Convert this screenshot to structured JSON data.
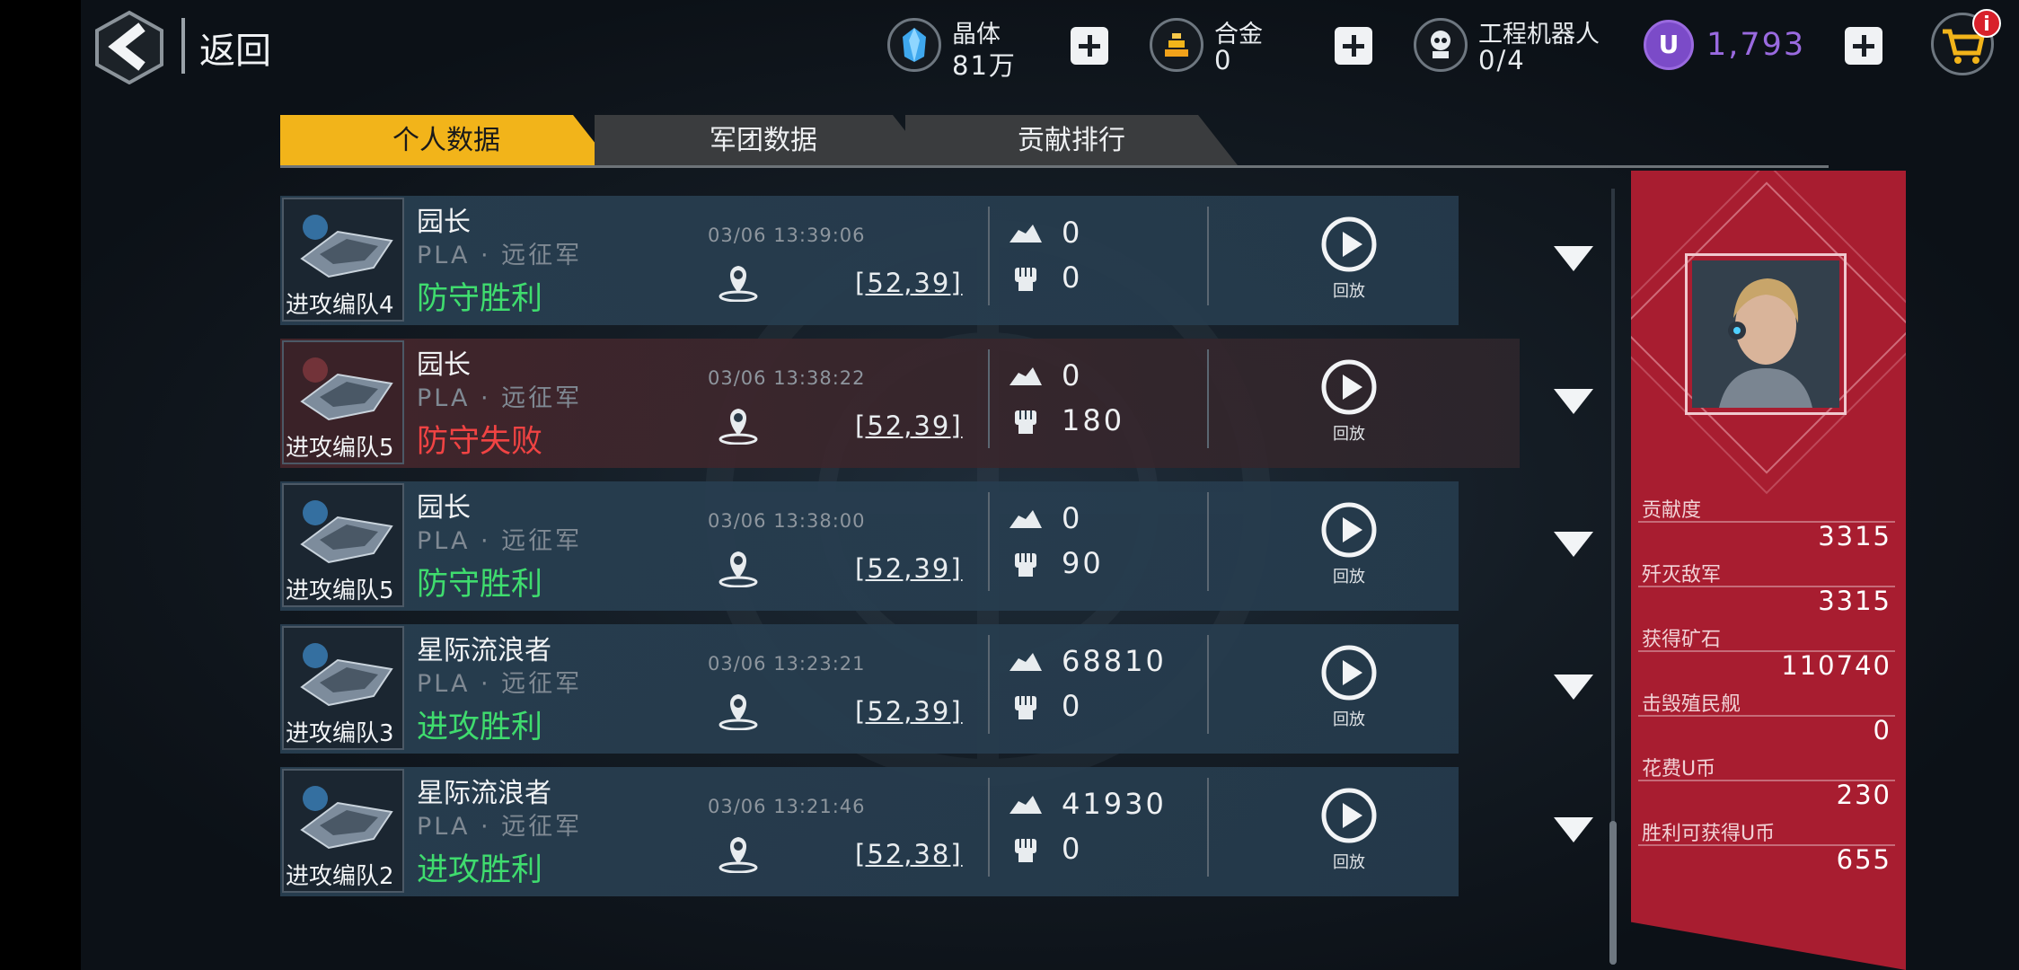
{
  "header": {
    "back_label": "返回",
    "resources": {
      "crystal": {
        "name": "晶体",
        "value": "81万"
      },
      "alloy": {
        "name": "合金",
        "value": "0"
      },
      "robot": {
        "name": "工程机器人",
        "value": "0/4"
      },
      "u_coin": {
        "symbol": "U",
        "value": "1,793"
      }
    },
    "cart_badge": "i"
  },
  "tabs": [
    {
      "label": "个人数据",
      "active": true
    },
    {
      "label": "军团数据",
      "active": false
    },
    {
      "label": "贡献排行",
      "active": false
    }
  ],
  "records": [
    {
      "unit": "进攻编队4",
      "name": "园长",
      "guild": "PLA · 远征军",
      "result": "防守胜利",
      "outcome": "win",
      "time": "03/06 13:39:06",
      "coord": "[52,39]",
      "ore": "0",
      "kills": "0",
      "replay": "回放"
    },
    {
      "unit": "进攻编队5",
      "name": "园长",
      "guild": "PLA · 远征军",
      "result": "防守失败",
      "outcome": "lose",
      "time": "03/06 13:38:22",
      "coord": "[52,39]",
      "ore": "0",
      "kills": "180",
      "replay": "回放"
    },
    {
      "unit": "进攻编队5",
      "name": "园长",
      "guild": "PLA · 远征军",
      "result": "防守胜利",
      "outcome": "win",
      "time": "03/06 13:38:00",
      "coord": "[52,39]",
      "ore": "0",
      "kills": "90",
      "replay": "回放"
    },
    {
      "unit": "进攻编队3",
      "name": "星际流浪者",
      "guild": "PLA · 远征军",
      "result": "进攻胜利",
      "outcome": "win",
      "time": "03/06 13:23:21",
      "coord": "[52,39]",
      "ore": "68810",
      "kills": "0",
      "replay": "回放"
    },
    {
      "unit": "进攻编队2",
      "name": "星际流浪者",
      "guild": "PLA · 远征军",
      "result": "进攻胜利",
      "outcome": "win",
      "time": "03/06 13:21:46",
      "coord": "[52,38]",
      "ore": "41930",
      "kills": "0",
      "replay": "回放"
    }
  ],
  "summary": [
    {
      "label": "贡献度",
      "value": "3315"
    },
    {
      "label": "歼灭敌军",
      "value": "3315"
    },
    {
      "label": "获得矿石",
      "value": "110740"
    },
    {
      "label": "击毁殖民舰",
      "value": "0"
    },
    {
      "label": "花费U币",
      "value": "230"
    },
    {
      "label": "胜利可获得U币",
      "value": "655"
    }
  ],
  "colors": {
    "tab_active": "#f2b41a",
    "win": "#3fdc6e",
    "lose": "#f04343",
    "panel": "#a81d30",
    "u_coin": "#9a6ae0"
  }
}
